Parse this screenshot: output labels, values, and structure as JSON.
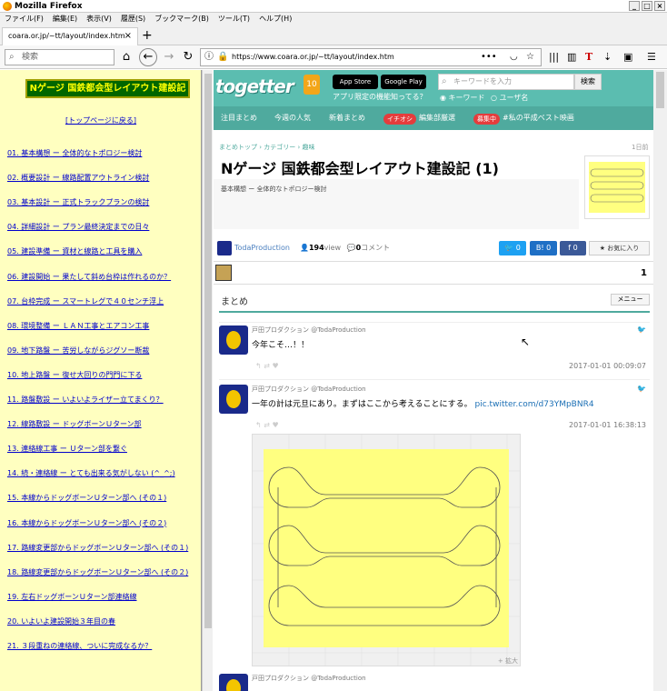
{
  "window": {
    "title": "Mozilla Firefox"
  },
  "menu": [
    "ファイル(F)",
    "編集(E)",
    "表示(V)",
    "履歴(S)",
    "ブックマーク(B)",
    "ツール(T)",
    "ヘルプ(H)"
  ],
  "tab": {
    "label": "coara.or.jp/~tt/layout/index.htm",
    "close": "×",
    "new": "+"
  },
  "nav": {
    "search_placeholder": "検索",
    "url": "https://www.coara.or.jp/~tt/layout/index.htm",
    "more": "•••"
  },
  "left": {
    "title": "Nゲージ 国鉄都会型レイアウト建設記",
    "back": "[トップページに戻る]",
    "links": [
      "01. 基本構想 ー 全体的なトポロジー検討",
      "02. 概要設計 ー 線路配置アウトライン検討",
      "03. 基本設計 ー 正式トラックプランの検討",
      "04. 詳細設計 ー プラン最終決定までの日々",
      "05. 建設準備 ー 資材と線路と工具を購入",
      "06. 建設開始 ー 果たして斜め台枠は作れるのか？",
      "07. 台枠完成 ー スマートレグで４０センチ浮上",
      "08. 環境整備 ー ＬＡＮ工事とエアコン工事",
      "09. 地下路盤 ー 苦労しながらジグソー断裁",
      "10. 地上路盤 ー 復せ大回りの門門に下る",
      "11. 路盤敷設 ー いよいよライザー立てまくり？",
      "12. 線路敷設 ー ドッグボーンＵターン部",
      "13. 連絡線工事 ー Ｕターン部を繋ぐ",
      "14. 続・連絡線 ー とても出来る気がしない (^_^;)",
      "15. 本線からドッグボーンＵターン部へ (その１)",
      "16. 本線からドッグボーンＵターン部へ (その２)",
      "17. 路線変更部からドッグボーンＵターン部へ (その１)",
      "18. 路線変更部からドッグボーンＵターン部へ (その２)",
      "19. 左右ドッグボーンＵターン部連絡線",
      "20. いよいよ建設開始３年目の春",
      "21. ３段重ねの連絡線、ついに完成なるか？"
    ]
  },
  "togetter": {
    "logo": "togetter",
    "badge": "10",
    "appstore": "App Store",
    "googleplay": "Google Play",
    "app_note": "アプリ限定の機能知ってる？",
    "search_placeholder": "キーワードを入力",
    "search_button": "検索",
    "radio_keyword": "◉ キーワード",
    "radio_user": "○ ユーザ名",
    "nav": [
      "注目まとめ",
      "今週の人気",
      "新着まとめ",
      "イチオシ",
      "編集部厳選",
      "募集中",
      "#私の平成ベスト映画"
    ],
    "breadcrumb": "まとめトップ › カテゴリー › 趣味",
    "date_hint": "1日前",
    "title": "Nゲージ 国鉄都会型レイアウト建設記 (1)",
    "description": "基本構想 ー 全体的なトポロジー検討",
    "author": "TodaProduction",
    "views": "194",
    "views_unit": "view",
    "comments": "0",
    "comments_unit": "コメント",
    "tw_count": "0",
    "hb_count": "0",
    "fb_count": "0",
    "tw_label": "",
    "hb_label": "B!",
    "fb_label": "f",
    "fav": "★ お気に入り",
    "page_num": "1",
    "section": "まとめ",
    "menu_btn": "メニュー",
    "tweets": [
      {
        "user": "戸田プロダクション @TodaProduction",
        "text": "今年こそ…！！",
        "link": "",
        "time": "2017-01-01 00:09:07"
      },
      {
        "user": "戸田プロダクション @TodaProduction",
        "text": "一年の計は元旦にあり。まずはここから考えることにする。",
        "link": "pic.twitter.com/d73YMpBNR4",
        "time": "2017-01-01 16:38:13"
      },
      {
        "user": "戸田プロダクション @TodaProduction",
        "text": "",
        "link": "",
        "time": ""
      }
    ],
    "tweet_actions": "↰  ⇄  ♥",
    "bird": "🐦",
    "img_caption": "+ 拡大"
  }
}
